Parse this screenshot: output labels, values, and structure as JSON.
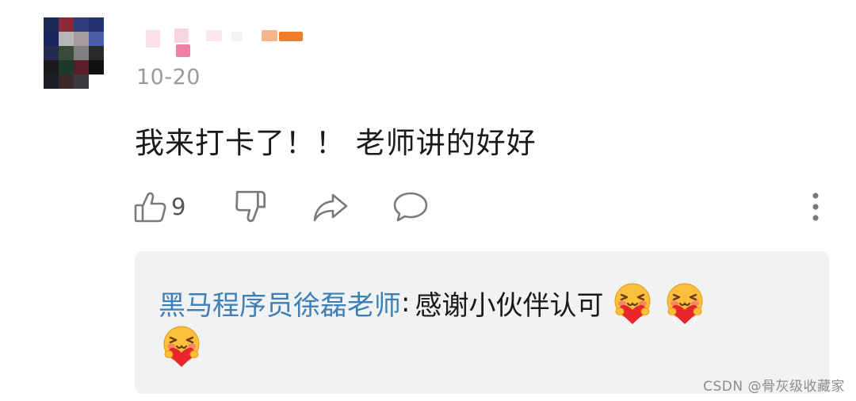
{
  "comment": {
    "date": "10-20",
    "text": "我来打卡了！！ 老师讲的好好",
    "like_count": "9"
  },
  "reply": {
    "author": "黑马程序员徐磊老师",
    "separator": ":",
    "text": "感谢小伙伴认可",
    "emoji_count": 3
  },
  "watermark": "CSDN @骨灰级收藏家",
  "icons": {
    "like": "thumbs-up-icon",
    "dislike": "thumbs-down-icon",
    "share": "share-arrow-icon",
    "reply": "chat-bubble-icon",
    "more": "more-vertical-icon",
    "emoji": "blush-heart-emoji"
  },
  "colors": {
    "author_link": "#3d7fb6",
    "reply_bg": "#f1f2f4",
    "meta_gray": "#9a9a9a",
    "icon_gray": "#7a7a7a"
  }
}
